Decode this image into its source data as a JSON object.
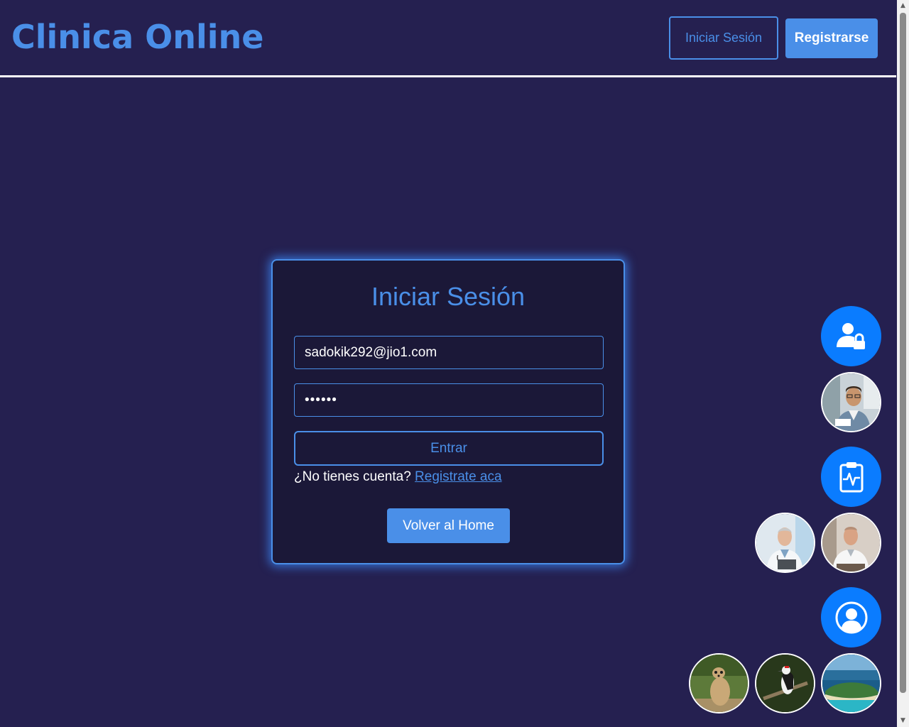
{
  "header": {
    "brand": "Clinica Online",
    "login_label": "Iniciar Sesión",
    "register_label": "Registrarse"
  },
  "login": {
    "title": "Iniciar Sesión",
    "email_value": "sadokik292@jio1.com",
    "password_value": "••••••",
    "submit_label": "Entrar",
    "no_account_text": "¿No tienes cuenta?",
    "register_link": "Registrate aca",
    "home_label": "Volver al Home"
  },
  "quick_access": [
    {
      "type": "button",
      "icon": "user-lock-icon"
    },
    {
      "type": "avatar",
      "icon": "doctor-photo-1"
    },
    {
      "type": "button",
      "icon": "clipboard-pulse-icon"
    },
    {
      "type": "avatar",
      "icon": "doctor-photo-2"
    },
    {
      "type": "avatar",
      "icon": "doctor-photo-3"
    },
    {
      "type": "button",
      "icon": "user-circle-icon"
    },
    {
      "type": "avatar",
      "icon": "meerkat-photo"
    },
    {
      "type": "avatar",
      "icon": "woodpecker-photo"
    },
    {
      "type": "avatar",
      "icon": "island-photo"
    }
  ],
  "colors": {
    "background": "#252050",
    "card": "#1b1838",
    "accent": "#4a8fe8",
    "fab": "#0a7cff"
  }
}
